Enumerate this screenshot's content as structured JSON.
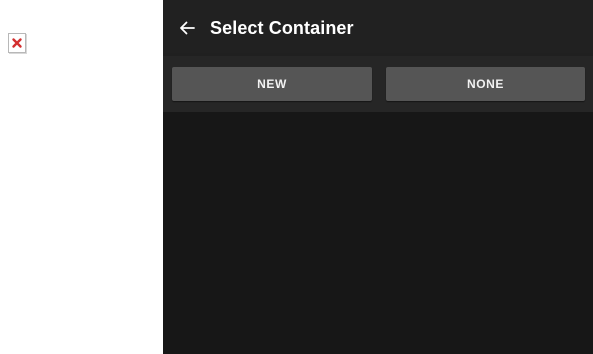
{
  "broken_image": {
    "icon": "broken-image-icon",
    "accent": "#d32f2f"
  },
  "app_bar": {
    "back_icon": "arrow-left-icon",
    "title": "Select Container"
  },
  "actions": {
    "new_label": "NEW",
    "none_label": "NONE"
  },
  "colors": {
    "panel_background": "#171717",
    "app_bar_background": "#212121",
    "button_background": "#555555",
    "text": "#ffffff"
  }
}
